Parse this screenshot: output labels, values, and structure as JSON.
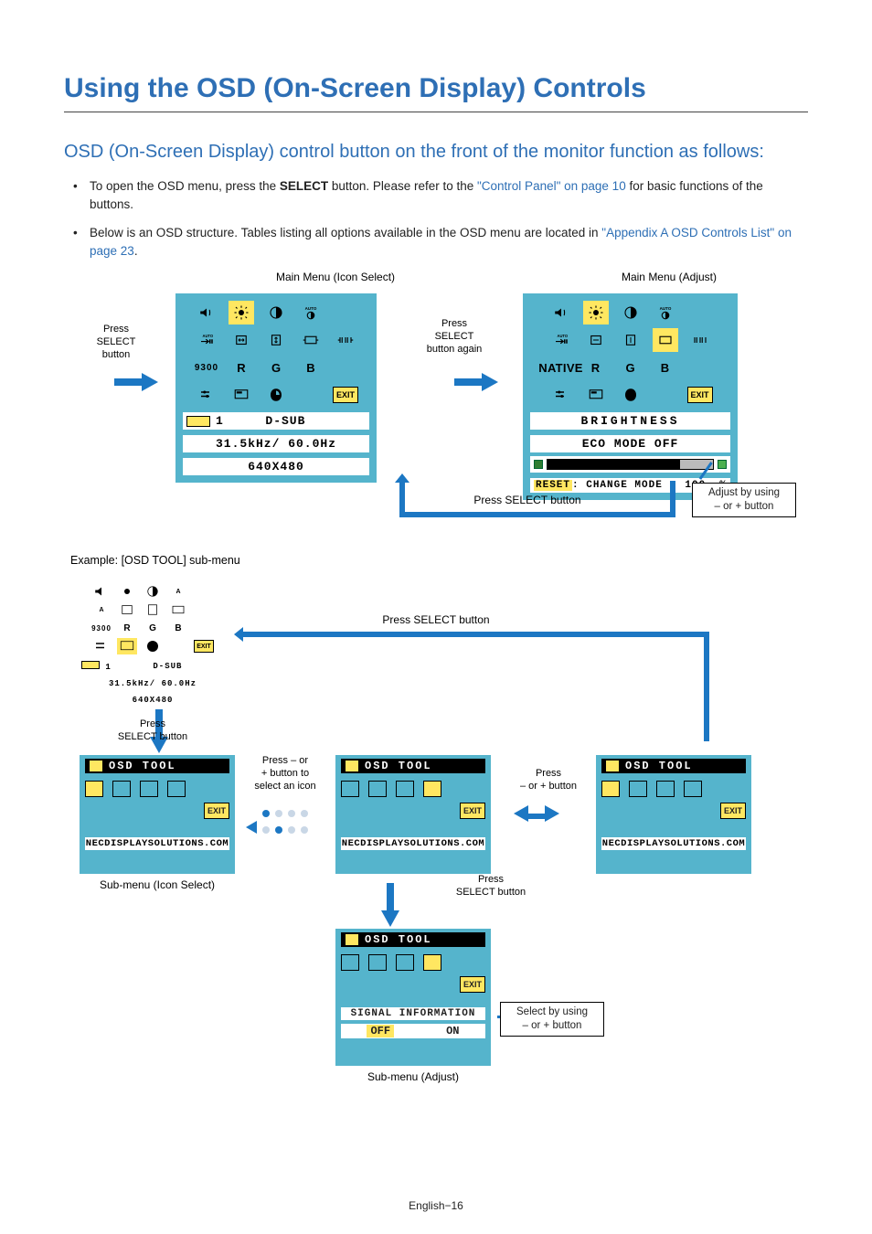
{
  "title": "Using the OSD (On-Screen Display) Controls",
  "subtitle": "OSD (On-Screen Display) control button on the front of the monitor function as follows:",
  "bullets": {
    "b1_pre": "To open the OSD menu, press the ",
    "b1_bold": "SELECT",
    "b1_mid": " button. Please refer to the ",
    "b1_link": "\"Control Panel\" on page 10",
    "b1_post": " for basic functions of the buttons.",
    "b2_pre": "Below is an OSD structure. Tables listing all options available in the OSD menu are located in ",
    "b2_link": "\"Appendix A OSD Controls List\" on page 23",
    "b2_post": "."
  },
  "caps": {
    "main_icon": "Main Menu (Icon Select)",
    "main_adjust": "Main Menu (Adjust)",
    "press_select": "Press\nSELECT\nbutton",
    "press_select_again": "Press\nSELECT\nbutton again",
    "press_select_btn": "Press SELECT button",
    "adjust_pm": "Adjust by using\n– or + button",
    "example": "Example: [OSD TOOL] sub-menu",
    "press_select2": "Press\nSELECT button",
    "press_pm_icon": "Press – or\n+ button to\nselect an icon",
    "press_pm": "Press\n– or + button",
    "sub_icon": "Sub-menu (Icon Select)",
    "sub_adjust": "Sub-menu (Adjust)",
    "select_pm": "Select by using\n– or + button",
    "press_select_single": "Press SELECT button",
    "press_select_stack": "Press\nSELECT button"
  },
  "osd": {
    "row3_9300": "9300",
    "row3_native": "NATIVE",
    "R": "R",
    "G": "G",
    "B": "B",
    "exit": "EXIT",
    "dsub_line": "D-SUB",
    "freq": "31.5kHz/ 60.0Hz",
    "res": "640X480",
    "brightness": "BRIGHTNESS",
    "eco": "ECO MODE OFF",
    "reset": "RESET",
    "change_mode": ": CHANGE MODE",
    "hundred": "100",
    "pct": "%",
    "one": "1"
  },
  "tool": {
    "header": "OSD TOOL",
    "ncd": "NECDISPLAYSOLUTIONS.COM",
    "siginfo": "SIGNAL INFORMATION",
    "off": "OFF",
    "on": "ON"
  },
  "footer": "English−16"
}
